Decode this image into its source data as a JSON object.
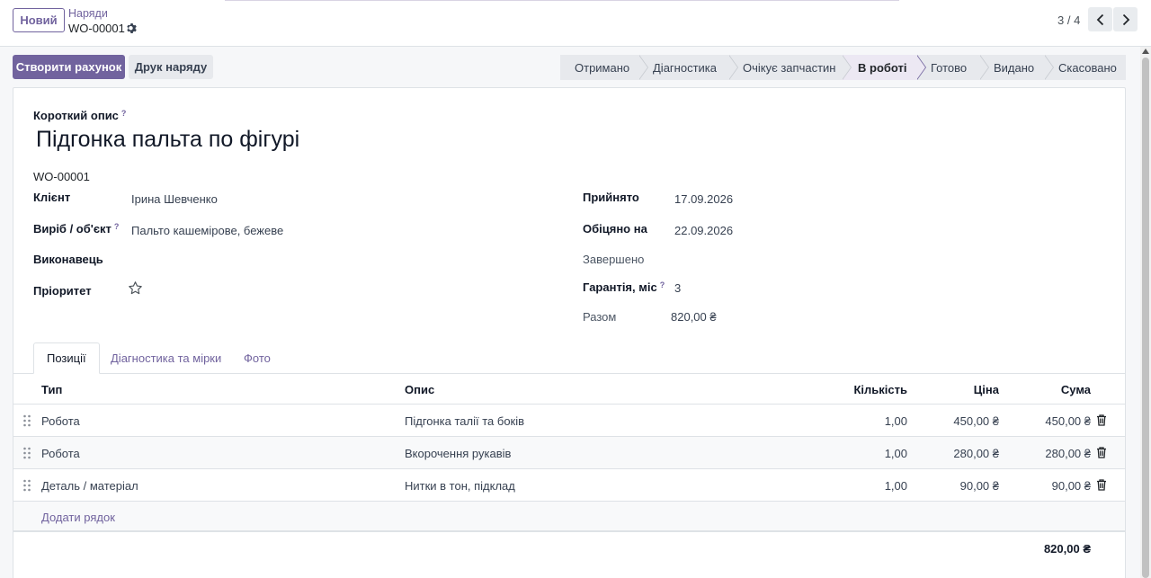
{
  "header": {
    "new_button": "Новий",
    "breadcrumb_parent": "Наряди",
    "breadcrumb_current": "WO-00001",
    "pager_text": "3 / 4"
  },
  "actions": {
    "create_invoice": "Створити рахунок",
    "print_order": "Друк наряду"
  },
  "statusbar": {
    "stages": [
      "Отримано",
      "Діагностика",
      "Очікує запчастин",
      "В роботі",
      "Готово",
      "Видано",
      "Скасовано"
    ],
    "active": "В роботі"
  },
  "form": {
    "short_desc_label": "Короткий опис",
    "help_mark": "?",
    "title": "Підгонка пальта по фігурі",
    "ref": "WO-00001",
    "client_label": "Клієнт",
    "client_value": "Ірина Шевченко",
    "item_label": "Виріб / об'єкт",
    "item_value": "Пальто кашемірове, бежеве",
    "executor_label": "Виконавець",
    "priority_label": "Пріоритет",
    "accepted_label": "Прийнято",
    "accepted_value": "17.09.2026",
    "promised_label": "Обіцяно на",
    "promised_value": "22.09.2026",
    "completed_label": "Завершено",
    "warranty_label": "Гарантія, міс",
    "warranty_value": "3",
    "total_label": "Разом",
    "total_value": "820,00 ₴"
  },
  "tabs": [
    "Позиції",
    "Діагностика та мірки",
    "Фото"
  ],
  "table": {
    "headers": {
      "type": "Тип",
      "desc": "Опис",
      "qty": "Кількість",
      "price": "Ціна",
      "sum": "Сума"
    },
    "rows": [
      {
        "type": "Робота",
        "desc": "Підгонка талії та боків",
        "qty": "1,00",
        "price": "450,00 ₴",
        "sum": "450,00 ₴"
      },
      {
        "type": "Робота",
        "desc": "Вкорочення рукавів",
        "qty": "1,00",
        "price": "280,00 ₴",
        "sum": "280,00 ₴"
      },
      {
        "type": "Деталь / матеріал",
        "desc": "Нитки в тон, підклад",
        "qty": "1,00",
        "price": "90,00 ₴",
        "sum": "90,00 ₴"
      }
    ],
    "add_line": "Додати рядок",
    "grand_total": "820,00 ₴"
  }
}
